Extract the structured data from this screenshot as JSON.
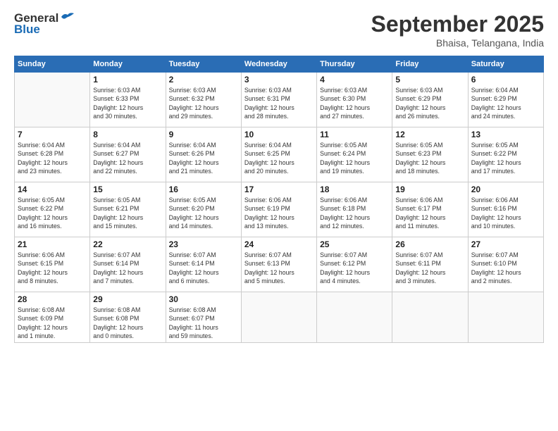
{
  "logo": {
    "text_general": "General",
    "text_blue": "Blue"
  },
  "header": {
    "month": "September 2025",
    "location": "Bhaisa, Telangana, India"
  },
  "weekdays": [
    "Sunday",
    "Monday",
    "Tuesday",
    "Wednesday",
    "Thursday",
    "Friday",
    "Saturday"
  ],
  "weeks": [
    [
      {
        "day": "",
        "info": ""
      },
      {
        "day": "1",
        "info": "Sunrise: 6:03 AM\nSunset: 6:33 PM\nDaylight: 12 hours\nand 30 minutes."
      },
      {
        "day": "2",
        "info": "Sunrise: 6:03 AM\nSunset: 6:32 PM\nDaylight: 12 hours\nand 29 minutes."
      },
      {
        "day": "3",
        "info": "Sunrise: 6:03 AM\nSunset: 6:31 PM\nDaylight: 12 hours\nand 28 minutes."
      },
      {
        "day": "4",
        "info": "Sunrise: 6:03 AM\nSunset: 6:30 PM\nDaylight: 12 hours\nand 27 minutes."
      },
      {
        "day": "5",
        "info": "Sunrise: 6:03 AM\nSunset: 6:29 PM\nDaylight: 12 hours\nand 26 minutes."
      },
      {
        "day": "6",
        "info": "Sunrise: 6:04 AM\nSunset: 6:29 PM\nDaylight: 12 hours\nand 24 minutes."
      }
    ],
    [
      {
        "day": "7",
        "info": "Sunrise: 6:04 AM\nSunset: 6:28 PM\nDaylight: 12 hours\nand 23 minutes."
      },
      {
        "day": "8",
        "info": "Sunrise: 6:04 AM\nSunset: 6:27 PM\nDaylight: 12 hours\nand 22 minutes."
      },
      {
        "day": "9",
        "info": "Sunrise: 6:04 AM\nSunset: 6:26 PM\nDaylight: 12 hours\nand 21 minutes."
      },
      {
        "day": "10",
        "info": "Sunrise: 6:04 AM\nSunset: 6:25 PM\nDaylight: 12 hours\nand 20 minutes."
      },
      {
        "day": "11",
        "info": "Sunrise: 6:05 AM\nSunset: 6:24 PM\nDaylight: 12 hours\nand 19 minutes."
      },
      {
        "day": "12",
        "info": "Sunrise: 6:05 AM\nSunset: 6:23 PM\nDaylight: 12 hours\nand 18 minutes."
      },
      {
        "day": "13",
        "info": "Sunrise: 6:05 AM\nSunset: 6:22 PM\nDaylight: 12 hours\nand 17 minutes."
      }
    ],
    [
      {
        "day": "14",
        "info": "Sunrise: 6:05 AM\nSunset: 6:22 PM\nDaylight: 12 hours\nand 16 minutes."
      },
      {
        "day": "15",
        "info": "Sunrise: 6:05 AM\nSunset: 6:21 PM\nDaylight: 12 hours\nand 15 minutes."
      },
      {
        "day": "16",
        "info": "Sunrise: 6:05 AM\nSunset: 6:20 PM\nDaylight: 12 hours\nand 14 minutes."
      },
      {
        "day": "17",
        "info": "Sunrise: 6:06 AM\nSunset: 6:19 PM\nDaylight: 12 hours\nand 13 minutes."
      },
      {
        "day": "18",
        "info": "Sunrise: 6:06 AM\nSunset: 6:18 PM\nDaylight: 12 hours\nand 12 minutes."
      },
      {
        "day": "19",
        "info": "Sunrise: 6:06 AM\nSunset: 6:17 PM\nDaylight: 12 hours\nand 11 minutes."
      },
      {
        "day": "20",
        "info": "Sunrise: 6:06 AM\nSunset: 6:16 PM\nDaylight: 12 hours\nand 10 minutes."
      }
    ],
    [
      {
        "day": "21",
        "info": "Sunrise: 6:06 AM\nSunset: 6:15 PM\nDaylight: 12 hours\nand 8 minutes."
      },
      {
        "day": "22",
        "info": "Sunrise: 6:07 AM\nSunset: 6:14 PM\nDaylight: 12 hours\nand 7 minutes."
      },
      {
        "day": "23",
        "info": "Sunrise: 6:07 AM\nSunset: 6:14 PM\nDaylight: 12 hours\nand 6 minutes."
      },
      {
        "day": "24",
        "info": "Sunrise: 6:07 AM\nSunset: 6:13 PM\nDaylight: 12 hours\nand 5 minutes."
      },
      {
        "day": "25",
        "info": "Sunrise: 6:07 AM\nSunset: 6:12 PM\nDaylight: 12 hours\nand 4 minutes."
      },
      {
        "day": "26",
        "info": "Sunrise: 6:07 AM\nSunset: 6:11 PM\nDaylight: 12 hours\nand 3 minutes."
      },
      {
        "day": "27",
        "info": "Sunrise: 6:07 AM\nSunset: 6:10 PM\nDaylight: 12 hours\nand 2 minutes."
      }
    ],
    [
      {
        "day": "28",
        "info": "Sunrise: 6:08 AM\nSunset: 6:09 PM\nDaylight: 12 hours\nand 1 minute."
      },
      {
        "day": "29",
        "info": "Sunrise: 6:08 AM\nSunset: 6:08 PM\nDaylight: 12 hours\nand 0 minutes."
      },
      {
        "day": "30",
        "info": "Sunrise: 6:08 AM\nSunset: 6:07 PM\nDaylight: 11 hours\nand 59 minutes."
      },
      {
        "day": "",
        "info": ""
      },
      {
        "day": "",
        "info": ""
      },
      {
        "day": "",
        "info": ""
      },
      {
        "day": "",
        "info": ""
      }
    ]
  ]
}
